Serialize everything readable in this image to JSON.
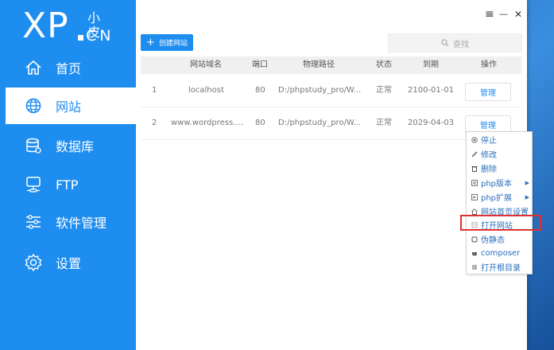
{
  "logo": {
    "main": "XP",
    "cn_top": "小皮",
    "cn_bottom": "CN"
  },
  "sidebar": {
    "items": [
      {
        "label": "首页",
        "icon": "home-icon"
      },
      {
        "label": "网站",
        "icon": "globe-icon",
        "active": true
      },
      {
        "label": "数据库",
        "icon": "database-icon"
      },
      {
        "label": "FTP",
        "icon": "ftp-icon"
      },
      {
        "label": "软件管理",
        "icon": "sliders-icon"
      },
      {
        "label": "设置",
        "icon": "gear-icon"
      }
    ]
  },
  "window_controls": {
    "menu": "≡",
    "minimize": "—",
    "close": "✕"
  },
  "toolbar": {
    "create_label": "创建网站",
    "create_icon": "+",
    "search_placeholder": "查找"
  },
  "table": {
    "headers": [
      "网站域名",
      "端口",
      "物理路径",
      "状态",
      "到期",
      "操作"
    ],
    "rows": [
      {
        "index": "1",
        "domain": "localhost",
        "port": "80",
        "path": "D:/phpstudy_pro/W...",
        "status": "正常",
        "expiry": "2100-01-01",
        "action": "管理"
      },
      {
        "index": "2",
        "domain": "www.wordpress....",
        "port": "80",
        "path": "D:/phpstudy_pro/W...",
        "status": "正常",
        "expiry": "2029-04-03",
        "action": "管理"
      }
    ]
  },
  "context_menu": {
    "items": [
      {
        "label": "停止",
        "icon": "stop-icon"
      },
      {
        "label": "修改",
        "icon": "edit-icon"
      },
      {
        "label": "删除",
        "icon": "trash-icon"
      },
      {
        "label": "php版本",
        "icon": "php-icon",
        "submenu": true
      },
      {
        "label": "php扩展",
        "icon": "extension-icon",
        "submenu": true
      },
      {
        "label": "网站首页设置",
        "icon": "home-icon"
      },
      {
        "label": "打开网站",
        "icon": "open-icon",
        "highlighted": true
      },
      {
        "label": "伪静态",
        "icon": "rewrite-icon"
      },
      {
        "label": "composer",
        "icon": "composer-icon"
      },
      {
        "label": "打开根目录",
        "icon": "folder-list-icon"
      }
    ]
  },
  "colors": {
    "accent": "#1e8df0",
    "highlight_border": "#e03030"
  }
}
